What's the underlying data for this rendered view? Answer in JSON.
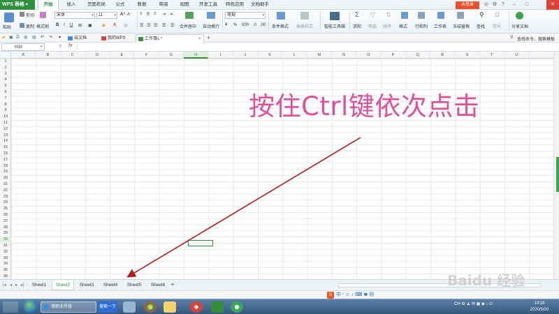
{
  "app": {
    "logo": "WPS 表格",
    "login": "未登录"
  },
  "menu_tabs": [
    "开始",
    "插入",
    "页面布局",
    "公式",
    "数据",
    "审阅",
    "视图",
    "开发工具",
    "特色应用",
    "文档助手"
  ],
  "ribbon": {
    "cut": "剪切",
    "paste": "粘贴",
    "copy": "复制",
    "format_painter": "格式刷",
    "font_name": "宋体",
    "font_size": "11",
    "number_format": "常规",
    "merge_center": "合并居中",
    "auto_wrap": "自动换行",
    "conditional_format": "条件格式",
    "table_style": "表格样式",
    "smart_toolbox": "智能工具箱",
    "sum": "求和",
    "filter": "筛选",
    "sort": "排序",
    "format": "格式",
    "row_col": "行和列",
    "worksheet": "工作表",
    "freeze": "冻结窗格",
    "find": "查找",
    "symbol": "符号",
    "share": "分享文档",
    "search_hint": "查找命令、搜索模板"
  },
  "doc_tabs": [
    {
      "label": "云文档",
      "color": "#3a8ee6"
    },
    {
      "label": "我的WPS",
      "color": "#d9433a"
    },
    {
      "label": "工作簿1 *",
      "color": "#2f8f3a"
    }
  ],
  "formula_bar": {
    "cell_ref": "H30",
    "fx": "fx"
  },
  "columns": [
    "A",
    "B",
    "C",
    "D",
    "E",
    "F",
    "G",
    "H",
    "I",
    "J",
    "K",
    "L",
    "M",
    "N",
    "O",
    "P",
    "Q",
    "R",
    "S",
    "T",
    "U"
  ],
  "rows": [
    "1",
    "2",
    "3",
    "4",
    "5",
    "6",
    "7",
    "8",
    "9",
    "10",
    "11",
    "12",
    "13",
    "14",
    "15",
    "16",
    "17",
    "18",
    "19",
    "20",
    "21",
    "22",
    "23",
    "24",
    "25",
    "26",
    "27",
    "28",
    "29",
    "30",
    "31",
    "32",
    "33",
    "34",
    "35",
    "36"
  ],
  "selected": {
    "column": "H",
    "row": "30"
  },
  "annotation": "按住Ctrl键依次点击",
  "sheets": [
    "Sheet1",
    "Sheet2",
    "Sheet3",
    "Sheet4",
    "Sheet5",
    "Sheet6"
  ],
  "active_sheet": "Sheet2",
  "ime": "中",
  "watermark": "Baidu 经验",
  "taskbar": {
    "ie_label": "单职业传奇",
    "search": "搜索一下",
    "tray_lang": "CH",
    "time": "14:18",
    "date": "2020/5/20"
  },
  "colors": {
    "accent": "#2f8f3a",
    "annotation": "#e0509a",
    "arrow": "#b01c1c"
  }
}
